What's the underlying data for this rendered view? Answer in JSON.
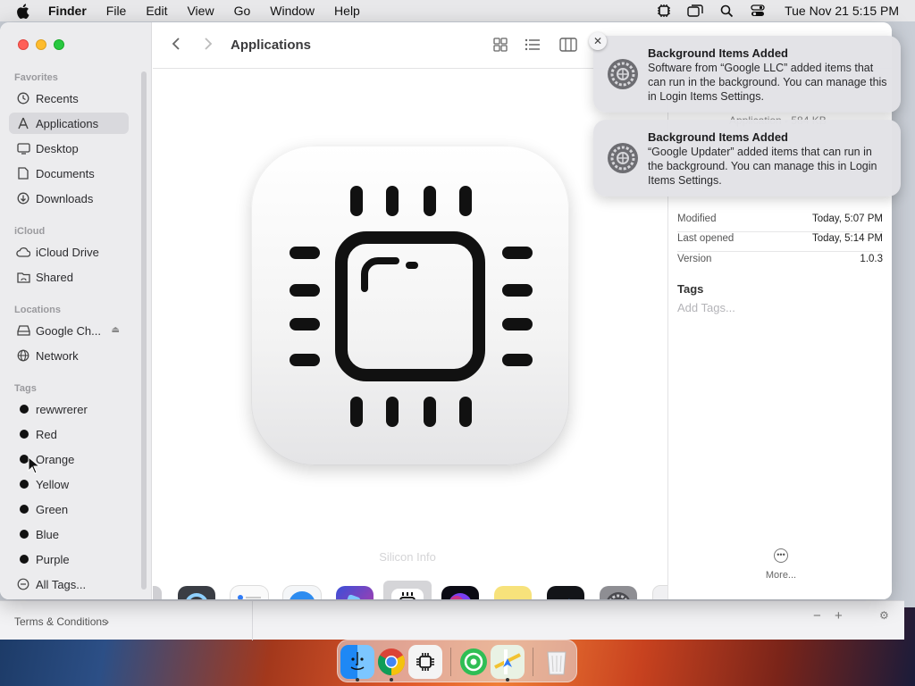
{
  "menubar": {
    "app_name": "Finder",
    "menus": [
      "File",
      "Edit",
      "View",
      "Go",
      "Window",
      "Help"
    ],
    "status_icons": [
      "chip-icon",
      "window-icon",
      "search-icon",
      "control-center-icon"
    ],
    "clock": "Tue Nov 21  5:15 PM"
  },
  "window": {
    "title": "Applications"
  },
  "sidebar": {
    "favorites_header": "Favorites",
    "favorites": [
      {
        "label": "Recents",
        "icon": "clock-icon"
      },
      {
        "label": "Applications",
        "icon": "applications-icon",
        "selected": true
      },
      {
        "label": "Desktop",
        "icon": "desktop-icon"
      },
      {
        "label": "Documents",
        "icon": "document-icon"
      },
      {
        "label": "Downloads",
        "icon": "download-icon"
      }
    ],
    "icloud_header": "iCloud",
    "icloud": [
      {
        "label": "iCloud Drive",
        "icon": "cloud-icon"
      },
      {
        "label": "Shared",
        "icon": "shared-folder-icon"
      }
    ],
    "locations_header": "Locations",
    "locations": [
      {
        "label": "Google Ch...",
        "icon": "drive-icon"
      },
      {
        "label": "Network",
        "icon": "globe-icon"
      }
    ],
    "tags_header": "Tags",
    "tags": [
      {
        "label": "rewwrerer"
      },
      {
        "label": "Red"
      },
      {
        "label": "Orange"
      },
      {
        "label": "Yellow"
      },
      {
        "label": "Green"
      },
      {
        "label": "Blue"
      },
      {
        "label": "Purple"
      }
    ],
    "all_tags": "All Tags..."
  },
  "gallery": {
    "preview_name": "Silicon Info",
    "thumbnails": [
      "app-thumb",
      "quicktime-icon",
      "reminders-icon",
      "safari-icon",
      "shortcuts-icon",
      "silicon-info-icon",
      "siri-icon",
      "stickies-icon",
      "stocks-icon",
      "system-settings-icon",
      "app-thumb"
    ]
  },
  "info": {
    "kind": "Application - 584 KB",
    "modified_label": "Modified",
    "modified_value": "Today, 5:07 PM",
    "last_opened_label": "Last opened",
    "last_opened_value": "Today, 5:14 PM",
    "version_label": "Version",
    "version_value": "1.0.3",
    "tags_header": "Tags",
    "add_tags": "Add Tags...",
    "more_label": "More..."
  },
  "notifications": [
    {
      "title": "Background Items Added",
      "body": "Software from “Google LLC” added items that can run in the background. You can manage this in Login Items Settings."
    },
    {
      "title": "Background Items Added",
      "body": "“Google Updater” added items that can run in the background. You can manage this in Login Items Settings."
    }
  ],
  "background_window": {
    "terms": "Terms & Conditions",
    "minus": "−",
    "plus": "+"
  },
  "dock": {
    "apps": [
      "finder-icon",
      "chrome-icon",
      "silicon-info-icon",
      "find-my-icon",
      "maps-icon",
      "trash-icon"
    ]
  },
  "colors": {
    "close": "#ff5f57",
    "minimize": "#febc2e",
    "zoom": "#28c840",
    "selection": "#d9d9dd"
  }
}
